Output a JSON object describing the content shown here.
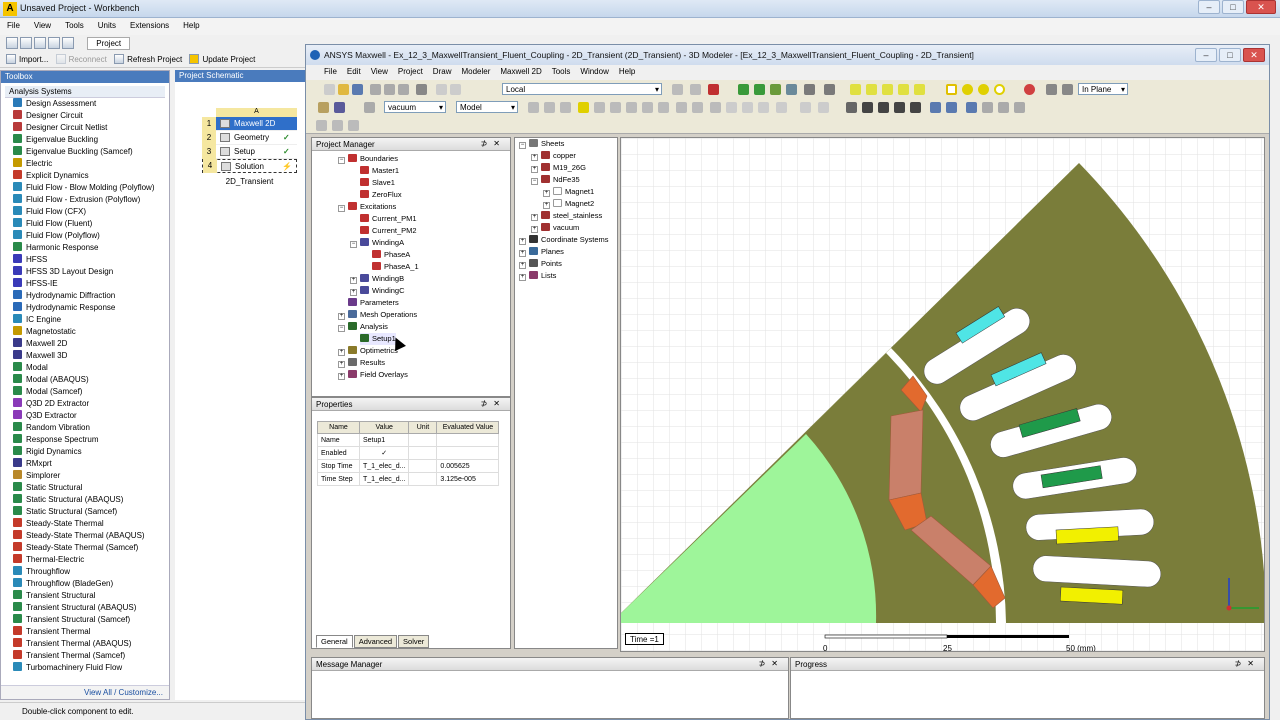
{
  "workbench": {
    "title": "Unsaved Project - Workbench",
    "menu": [
      "File",
      "View",
      "Tools",
      "Units",
      "Extensions",
      "Help"
    ],
    "toolbar_tab": "Project",
    "toolbar2": {
      "import": "Import...",
      "reconnect": "Reconnect",
      "refresh": "Refresh Project",
      "update": "Update Project"
    },
    "status": "Double-click component to edit."
  },
  "toolbox": {
    "title": "Toolbox",
    "group": "Analysis Systems",
    "items": [
      {
        "label": "Design Assessment",
        "color": "#2a7ab8"
      },
      {
        "label": "Designer Circuit",
        "color": "#b83a3a"
      },
      {
        "label": "Designer Circuit Netlist",
        "color": "#b83a3a"
      },
      {
        "label": "Eigenvalue Buckling",
        "color": "#2a8a4a"
      },
      {
        "label": "Eigenvalue Buckling (Samcef)",
        "color": "#2a8a4a"
      },
      {
        "label": "Electric",
        "color": "#c49a00"
      },
      {
        "label": "Explicit Dynamics",
        "color": "#c43a2a"
      },
      {
        "label": "Fluid Flow - Blow Molding (Polyflow)",
        "color": "#2a8ab8"
      },
      {
        "label": "Fluid Flow - Extrusion (Polyflow)",
        "color": "#2a8ab8"
      },
      {
        "label": "Fluid Flow (CFX)",
        "color": "#2a8ab8"
      },
      {
        "label": "Fluid Flow (Fluent)",
        "color": "#2a8ab8"
      },
      {
        "label": "Fluid Flow (Polyflow)",
        "color": "#2a8ab8"
      },
      {
        "label": "Harmonic Response",
        "color": "#2a8a4a"
      },
      {
        "label": "HFSS",
        "color": "#3a3ab8"
      },
      {
        "label": "HFSS 3D Layout Design",
        "color": "#3a3ab8"
      },
      {
        "label": "HFSS-IE",
        "color": "#3a3ab8"
      },
      {
        "label": "Hydrodynamic Diffraction",
        "color": "#2a6ab8"
      },
      {
        "label": "Hydrodynamic Response",
        "color": "#2a6ab8"
      },
      {
        "label": "IC Engine",
        "color": "#2a8ab8"
      },
      {
        "label": "Magnetostatic",
        "color": "#c49a00"
      },
      {
        "label": "Maxwell 2D",
        "color": "#3a3a8a"
      },
      {
        "label": "Maxwell 3D",
        "color": "#3a3a8a"
      },
      {
        "label": "Modal",
        "color": "#2a8a4a"
      },
      {
        "label": "Modal (ABAQUS)",
        "color": "#2a8a4a"
      },
      {
        "label": "Modal (Samcef)",
        "color": "#2a8a4a"
      },
      {
        "label": "Q3D 2D Extractor",
        "color": "#8a3ab8"
      },
      {
        "label": "Q3D Extractor",
        "color": "#8a3ab8"
      },
      {
        "label": "Random Vibration",
        "color": "#2a8a4a"
      },
      {
        "label": "Response Spectrum",
        "color": "#2a8a4a"
      },
      {
        "label": "Rigid Dynamics",
        "color": "#2a8a4a"
      },
      {
        "label": "RMxprt",
        "color": "#3a3a8a"
      },
      {
        "label": "Simplorer",
        "color": "#b8882a"
      },
      {
        "label": "Static Structural",
        "color": "#2a8a4a"
      },
      {
        "label": "Static Structural (ABAQUS)",
        "color": "#2a8a4a"
      },
      {
        "label": "Static Structural (Samcef)",
        "color": "#2a8a4a"
      },
      {
        "label": "Steady-State Thermal",
        "color": "#c43a2a"
      },
      {
        "label": "Steady-State Thermal (ABAQUS)",
        "color": "#c43a2a"
      },
      {
        "label": "Steady-State Thermal (Samcef)",
        "color": "#c43a2a"
      },
      {
        "label": "Thermal-Electric",
        "color": "#c43a2a"
      },
      {
        "label": "Throughflow",
        "color": "#2a8ab8"
      },
      {
        "label": "Throughflow (BladeGen)",
        "color": "#2a8ab8"
      },
      {
        "label": "Transient Structural",
        "color": "#2a8a4a"
      },
      {
        "label": "Transient Structural (ABAQUS)",
        "color": "#2a8a4a"
      },
      {
        "label": "Transient Structural (Samcef)",
        "color": "#2a8a4a"
      },
      {
        "label": "Transient Thermal",
        "color": "#c43a2a"
      },
      {
        "label": "Transient Thermal (ABAQUS)",
        "color": "#c43a2a"
      },
      {
        "label": "Transient Thermal (Samcef)",
        "color": "#c43a2a"
      },
      {
        "label": "Turbomachinery Fluid Flow",
        "color": "#2a8ab8"
      }
    ],
    "view_all": "View All / Customize..."
  },
  "schematic": {
    "title": "Project Schematic",
    "column": "A",
    "rows": [
      {
        "n": "1",
        "label": "Maxwell 2D",
        "status": ""
      },
      {
        "n": "2",
        "label": "Geometry",
        "status": "✓"
      },
      {
        "n": "3",
        "label": "Setup",
        "status": "✓"
      },
      {
        "n": "4",
        "label": "Solution",
        "status": "⚡"
      }
    ],
    "system_name": "2D_Transient"
  },
  "maxwell": {
    "title": "ANSYS Maxwell - Ex_12_3_MaxwellTransient_Fluent_Coupling - 2D_Transient (2D_Transient) - 3D Modeler - [Ex_12_3_MaxwellTransient_Fluent_Coupling - 2D_Transient]",
    "menu": [
      "File",
      "Edit",
      "View",
      "Project",
      "Draw",
      "Modeler",
      "Maxwell 2D",
      "Tools",
      "Window",
      "Help"
    ],
    "coord_select": "Local",
    "material_select": "vacuum",
    "model_select": "Model",
    "plane_select": "In Plane"
  },
  "project_manager": {
    "title": "Project Manager",
    "nodes": [
      {
        "label": "Boundaries",
        "color": "#c03030"
      },
      {
        "label": "Master1",
        "color": "#c03030"
      },
      {
        "label": "Slave1",
        "color": "#c03030"
      },
      {
        "label": "ZeroFlux",
        "color": "#c03030"
      },
      {
        "label": "Excitations",
        "color": "#c03030"
      },
      {
        "label": "Current_PM1",
        "color": "#c03030"
      },
      {
        "label": "Current_PM2",
        "color": "#c03030"
      },
      {
        "label": "WindingA",
        "color": "#4a4a9a"
      },
      {
        "label": "PhaseA",
        "color": "#c03030"
      },
      {
        "label": "PhaseA_1",
        "color": "#c03030"
      },
      {
        "label": "WindingB",
        "color": "#4a4a9a"
      },
      {
        "label": "WindingC",
        "color": "#4a4a9a"
      },
      {
        "label": "Parameters",
        "color": "#6a3a8a"
      },
      {
        "label": "Mesh Operations",
        "color": "#4a6a9a"
      },
      {
        "label": "Analysis",
        "color": "#2a6a2a"
      },
      {
        "label": "Setup1",
        "color": "#2a6a2a"
      },
      {
        "label": "Optimetrics",
        "color": "#8a7a2a"
      },
      {
        "label": "Results",
        "color": "#6a6a6a"
      },
      {
        "label": "Field Overlays",
        "color": "#8a3a6a"
      }
    ]
  },
  "properties": {
    "title": "Properties",
    "headers": [
      "Name",
      "Value",
      "Unit",
      "Evaluated Value"
    ],
    "rows": [
      [
        "Name",
        "Setup1",
        "",
        ""
      ],
      [
        "Enabled",
        "✓",
        "",
        ""
      ],
      [
        "Stop Time",
        "T_1_elec_d...",
        "",
        "0.005625"
      ],
      [
        "Time Step",
        "T_1_elec_d...",
        "",
        "3.125e-005"
      ]
    ],
    "tabs": [
      "General",
      "Advanced",
      "Solver"
    ]
  },
  "model_tree": {
    "nodes": [
      {
        "label": "Sheets",
        "color": "#777"
      },
      {
        "label": "copper",
        "color": "#a03030"
      },
      {
        "label": "M19_26G",
        "color": "#a03030"
      },
      {
        "label": "NdFe35",
        "color": "#a03030"
      },
      {
        "label": "Magnet1",
        "color": "#999"
      },
      {
        "label": "Magnet2",
        "color": "#999"
      },
      {
        "label": "steel_stainless",
        "color": "#a03030"
      },
      {
        "label": "vacuum",
        "color": "#a03030"
      },
      {
        "label": "Coordinate Systems",
        "color": "#333"
      },
      {
        "label": "Planes",
        "color": "#3a6a9a"
      },
      {
        "label": "Points",
        "color": "#555"
      },
      {
        "label": "Lists",
        "color": "#8a3a6a"
      }
    ]
  },
  "viewport": {
    "time_label": "Time =1",
    "scale_labels": [
      "0",
      "25",
      "50 (mm)"
    ],
    "colors": {
      "stator": "#7a7d3a",
      "air": "#ffffff",
      "rotor": "#7a7d3a",
      "airgap_region": "#9ef59a",
      "magnet": "#c9806a",
      "magnet_tip": "#e26a2e",
      "coil_cyan": "#4fe5e5",
      "coil_green": "#1f9a4a",
      "coil_yellow": "#f2f000"
    }
  },
  "message_manager": {
    "title": "Message Manager"
  },
  "progress": {
    "title": "Progress"
  }
}
